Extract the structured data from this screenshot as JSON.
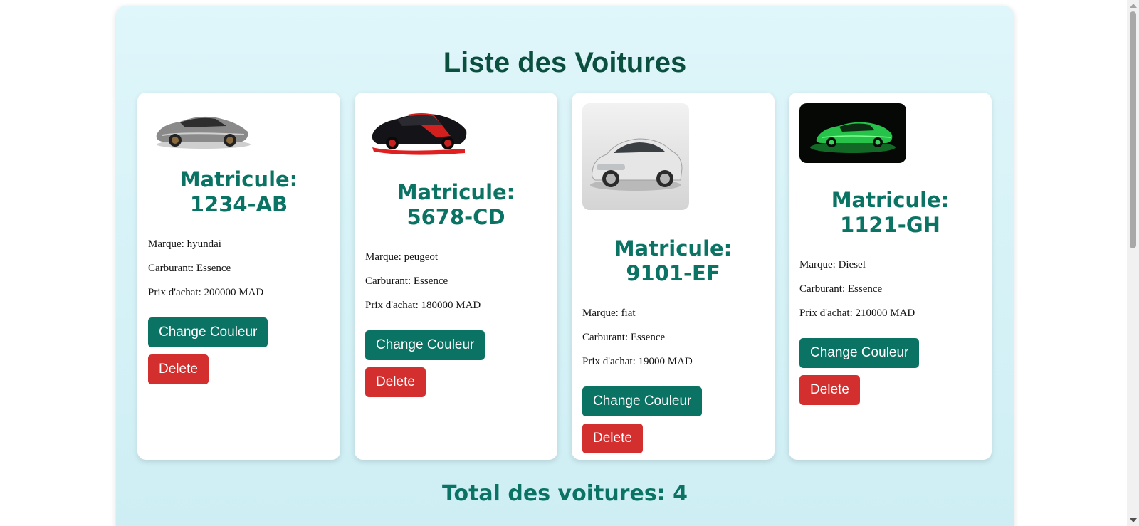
{
  "page": {
    "title": "Liste des Voitures",
    "total_label": "Total des voitures: 4"
  },
  "labels": {
    "change_color": "Change Couleur",
    "delete": "Delete"
  },
  "cars": [
    {
      "plate": "Matricule: 1234-AB",
      "plate_line1": "Matricule:",
      "plate_line2": "1234-AB",
      "marque": "Marque: hyundai",
      "carburant": "Carburant: Essence",
      "prix": "Prix d'achat: 200000 MAD",
      "image": "silver-sports-car-image"
    },
    {
      "plate": "Matricule: 5678-CD",
      "plate_line1": "Matricule:",
      "plate_line2": "5678-CD",
      "marque": "Marque: peugeot",
      "carburant": "Carburant: Essence",
      "prix": "Prix d'achat: 180000 MAD",
      "image": "black-red-sports-car-image"
    },
    {
      "plate": "Matricule: 9101-EF",
      "plate_line1": "Matricule:",
      "plate_line2": "9101-EF",
      "marque": "Marque: fiat",
      "carburant": "Carburant: Essence",
      "prix": "Prix d'achat: 19000 MAD",
      "image": "white-hatchback-image"
    },
    {
      "plate": "Matricule: 1121-GH",
      "plate_line1": "Matricule:",
      "plate_line2": "1121-GH",
      "marque": "Marque: Diesel",
      "carburant": "Carburant: Essence",
      "prix": "Prix d'achat: 210000 MAD",
      "image": "green-sports-car-image"
    }
  ],
  "colors": {
    "accent": "#0b7363",
    "title": "#0b4f3f",
    "delete": "#d32f2f",
    "panel": "#d8f3f8"
  }
}
